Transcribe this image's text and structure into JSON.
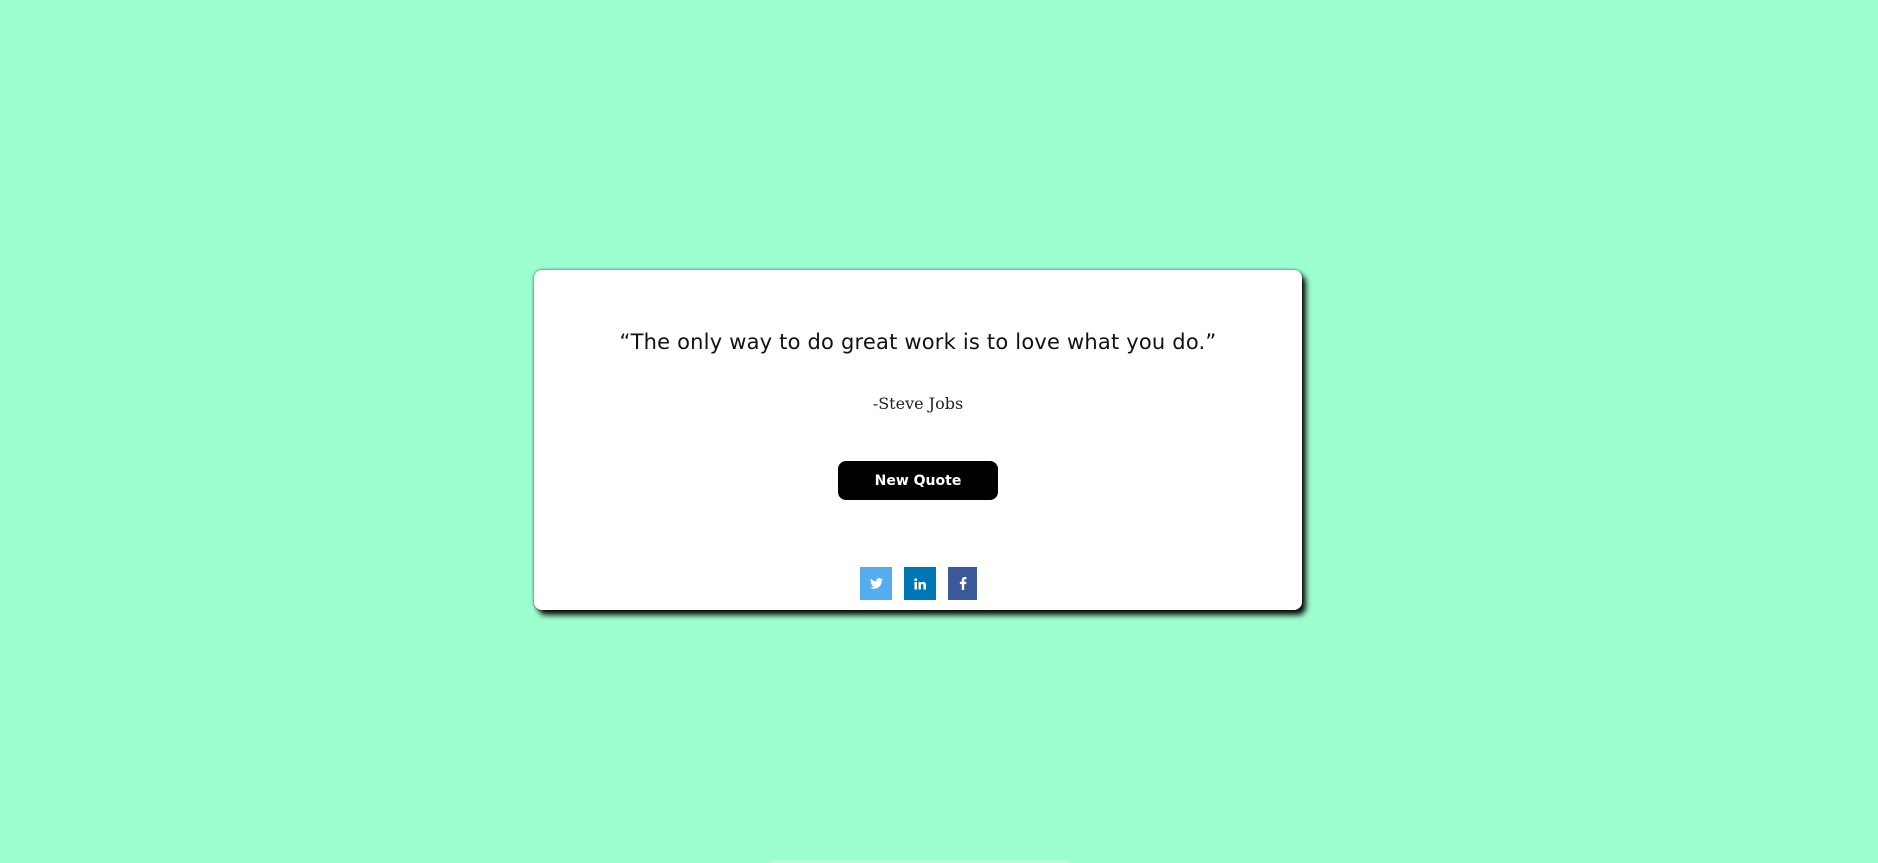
{
  "page": {
    "background_color": "#9dffcf"
  },
  "card": {
    "quote": "“The only way to do great work is to love what you do.”",
    "author": "-Steve Jobs",
    "new_quote_label": "New Quote"
  },
  "social": [
    {
      "name": "twitter",
      "icon": "twitter-icon",
      "color": "#55acee"
    },
    {
      "name": "linkedin",
      "icon": "linkedin-icon",
      "color": "#0077b5"
    },
    {
      "name": "facebook",
      "icon": "facebook-icon",
      "color": "#3b5998"
    }
  ]
}
